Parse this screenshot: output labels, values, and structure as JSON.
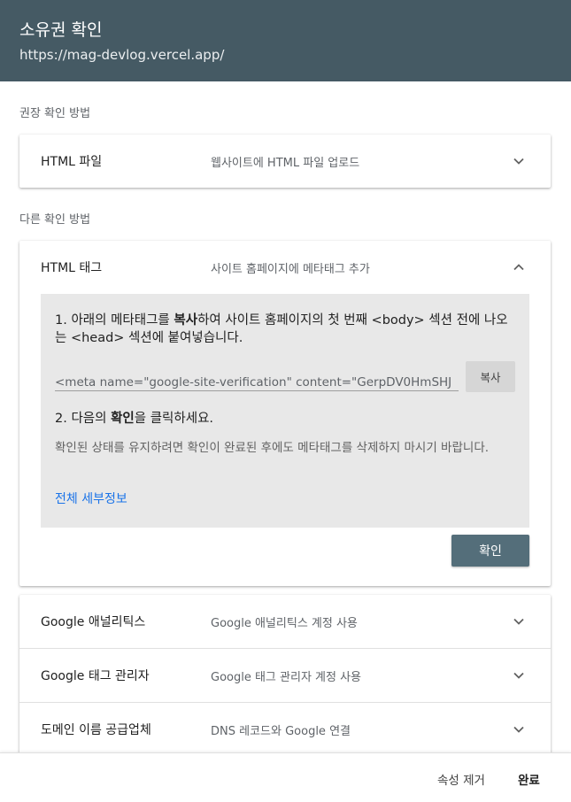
{
  "header": {
    "title": "소유권 확인",
    "url": "https://mag-devlog.vercel.app/"
  },
  "recommended": {
    "label": "권장 확인 방법",
    "method": {
      "name": "HTML 파일",
      "desc": "웹사이트에 HTML 파일 업로드",
      "icon": "chevron-down-icon"
    }
  },
  "other": {
    "label": "다른 확인 방법",
    "html_tag": {
      "name": "HTML 태그",
      "desc": "사이트 홈페이지에 메타태그 추가",
      "icon": "chevron-up-icon",
      "step1_prefix": "1. 아래의 메타태그를 ",
      "step1_bold": "복사",
      "step1_suffix": "하여 사이트 홈페이지의 첫 번째 <body> 섹션 전에 나오는 <head> 섹션에 붙여넣습니다.",
      "meta_tag_value": "<meta name=\"google-site-verification\" content=\"GerpDV0HmSHJ",
      "copy_label": "복사",
      "step2_prefix": "2. 다음의 ",
      "step2_bold": "확인",
      "step2_suffix": "을 클릭하세요.",
      "note": "확인된 상태를 유지하려면 확인이 완료된 후에도 메타태그를 삭제하지 마시기 바랍니다.",
      "details_link": "전체 세부정보",
      "confirm_label": "확인"
    },
    "methods": [
      {
        "name": "Google 애널리틱스",
        "desc": "Google 애널리틱스 계정 사용"
      },
      {
        "name": "Google 태그 관리자",
        "desc": "Google 태그 관리자 계정 사용"
      },
      {
        "name": "도메인 이름 공급업체",
        "desc": "DNS 레코드와 Google 연결"
      }
    ]
  },
  "footer": {
    "remove_label": "속성 제거",
    "done_label": "완료"
  },
  "colors": {
    "header_bg": "#455a64",
    "confirm_bg": "#546e7a",
    "link": "#1a73e8",
    "panel_bg": "#e8e8e8"
  }
}
